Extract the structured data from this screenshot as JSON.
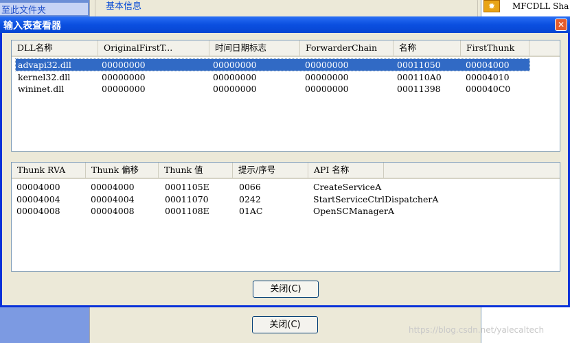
{
  "background": {
    "left_link": "至此文件夹",
    "group_title": "基本信息",
    "right_text": "MFCDLL Sha",
    "close_button": "关闭(C)",
    "watermark": "https://blog.csdn.net/yalecaltech"
  },
  "dialog": {
    "title": "输入表查看器",
    "close_glyph": "✕",
    "close_button": "关闭(C)",
    "imports": {
      "columns": [
        "DLL名称",
        "OriginalFirstT...",
        "时间日期标志",
        "ForwarderChain",
        "名称",
        "FirstThunk"
      ],
      "rows": [
        [
          "advapi32.dll",
          "00000000",
          "00000000",
          "00000000",
          "00011050",
          "00004000"
        ],
        [
          "kernel32.dll",
          "00000000",
          "00000000",
          "00000000",
          "000110A0",
          "00004010"
        ],
        [
          "wininet.dll",
          "00000000",
          "00000000",
          "00000000",
          "00011398",
          "000040C0"
        ]
      ],
      "selected_row": 0
    },
    "thunks": {
      "columns": [
        "Thunk RVA",
        "Thunk 偏移",
        "Thunk 值",
        "提示/序号",
        "API 名称"
      ],
      "rows": [
        [
          "00004000",
          "00004000",
          "0001105E",
          "0066",
          "CreateServiceA"
        ],
        [
          "00004004",
          "00004004",
          "00011070",
          "0242",
          "StartServiceCtrlDispatcherA"
        ],
        [
          "00004008",
          "00004008",
          "0001108E",
          "01AC",
          "OpenSCManagerA"
        ]
      ]
    }
  }
}
